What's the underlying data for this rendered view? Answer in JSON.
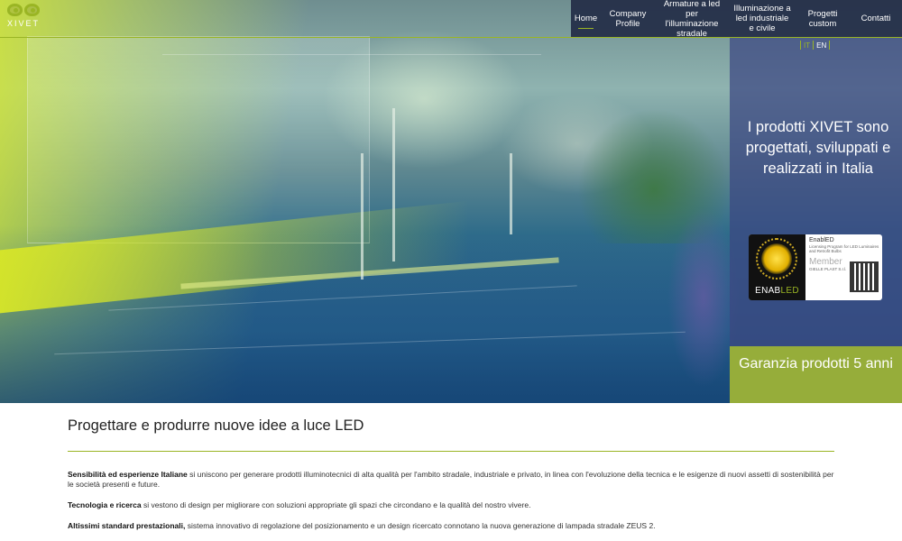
{
  "brand": {
    "name": "XIVET",
    "accent": "#9ab524",
    "nav_bg": "#232d46",
    "panel_bg": "#3c4682",
    "cta_bg": "#96ad3a"
  },
  "nav": {
    "items": [
      {
        "label": "Home",
        "active": true
      },
      {
        "label": "Company Profile"
      },
      {
        "label": "Armature a led per l'illuminazione stradale"
      },
      {
        "label": "Illuminazione a led industriale e civile"
      },
      {
        "label": "Progetti custom"
      },
      {
        "label": "Contatti"
      }
    ]
  },
  "language": {
    "it": "IT",
    "en": "EN",
    "selected": "IT"
  },
  "side_panel": {
    "claim": "I prodotti XIVET sono progettati, sviluppati e realizzati in Italia",
    "badge": {
      "logo_enab": "ENAB",
      "logo_led": "LED",
      "title": "EnablED",
      "subtitle": "Licensing Program for LED Luminaires and Retrofit Bulbs",
      "member": "Member",
      "company": "GIELLE PLAST S.r.l."
    },
    "cta": "Garanzia prodotti 5 anni"
  },
  "main": {
    "heading": "Progettare e produrre nuove idee a luce LED",
    "paragraphs": [
      {
        "bold": "Sensibilità ed esperienze Italiane",
        "text": " si uniscono per generare prodotti illuminotecnici di alta qualità per l'ambito stradale, industriale e privato, in linea con l'evoluzione della tecnica e le esigenze di nuovi assetti di sostenibilità per le società presenti e future."
      },
      {
        "bold": "Tecnologia e ricerca",
        "text": " si vestono di design per migliorare con soluzioni appropriate gli spazi che circondano e la qualità del nostro vivere."
      },
      {
        "bold": "Altissimi standard prestazionali,",
        "text": " sistema innovativo di regolazione del posizionamento e un design ricercato connotano la nuova generazione di lampada stradale ZEUS 2."
      }
    ]
  }
}
